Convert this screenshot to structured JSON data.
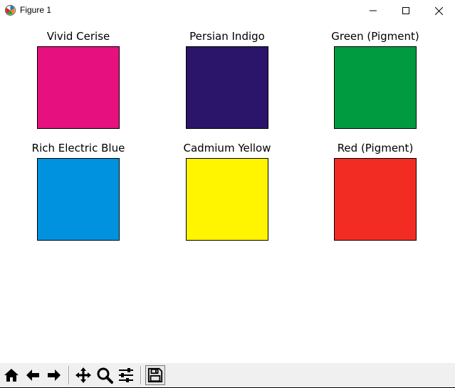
{
  "window": {
    "title": "Figure 1",
    "app_icon": "matplotlib-icon",
    "controls": [
      "minimize-icon",
      "maximize-icon",
      "close-icon"
    ]
  },
  "swatches": [
    {
      "title": "Vivid Cerise",
      "color": "#E6117F"
    },
    {
      "title": "Persian Indigo",
      "color": "#2A156B"
    },
    {
      "title": "Green (Pigment)",
      "color": "#009A41"
    },
    {
      "title": "Rich Electric Blue",
      "color": "#0092DF"
    },
    {
      "title": "Cadmium Yellow",
      "color": "#FFF500"
    },
    {
      "title": "Red (Pigment)",
      "color": "#F22C23"
    }
  ],
  "toolbar": {
    "buttons": [
      "home-icon",
      "back-icon",
      "forward-icon",
      "pan-icon",
      "zoom-icon",
      "configure-subplots-icon",
      "save-icon"
    ]
  }
}
